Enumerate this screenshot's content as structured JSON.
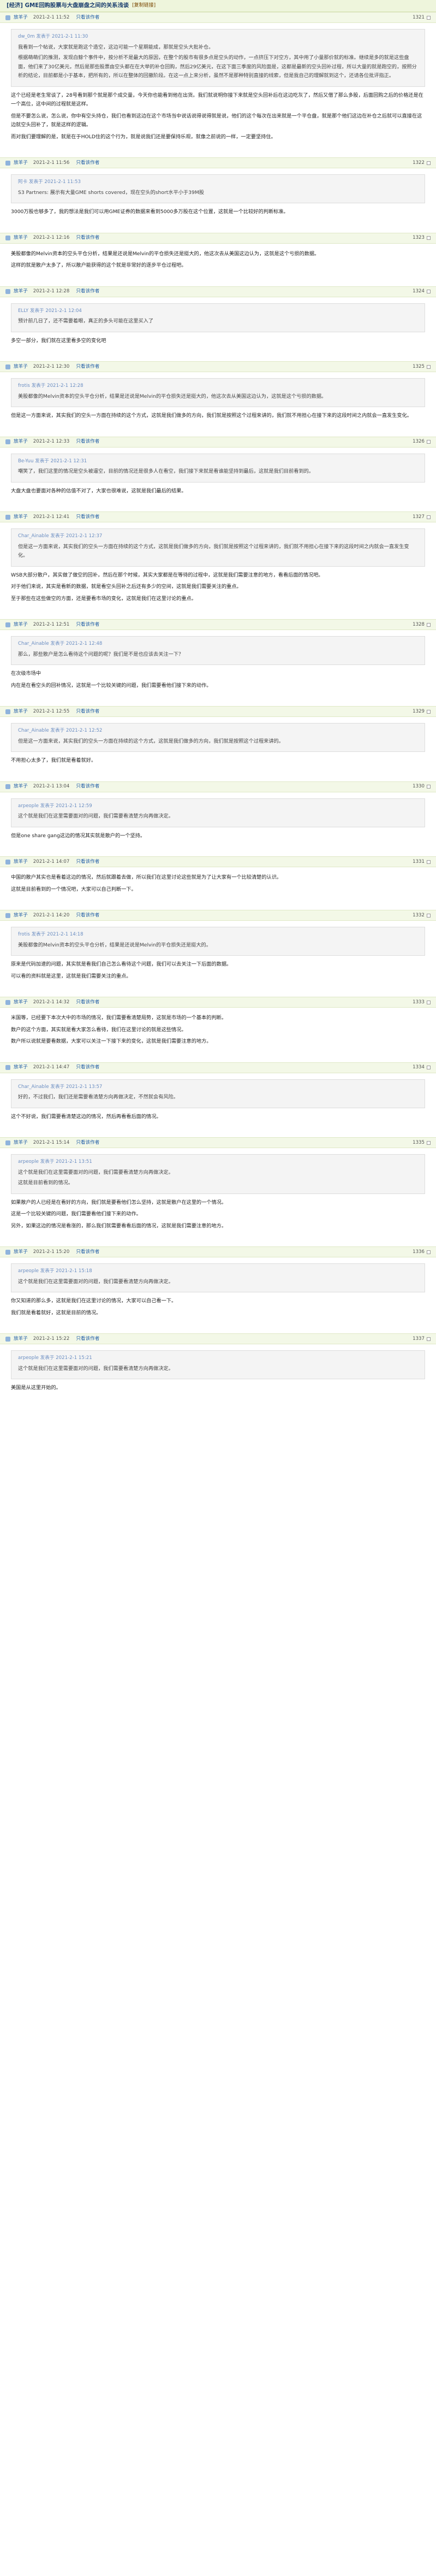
{
  "thread": {
    "title": "[经济] GME回购股票与大盘崩盘之间的关系浅谈",
    "tag": "[复制链接]"
  },
  "posts": [
    {
      "author": "放羊子",
      "time": "2021-2-1 11:52",
      "only_author": "只看该作者",
      "floor": "1321",
      "quote": {
        "meta": "dw_0m 发表于 2021-2-1 11:30",
        "paras": [
          "我看到一个帖说，大家就是跑这个造空，这边可能一个星期能成，那就是空头大批补仓。",
          "根据萌萌们的推测，发现白鲸个事件中，按分析不是最大的原因，在整个的股市有很多点是空头的动作，一点挤压下对空方，其中用了小量那价就的标准。继续是多的就是这些盘面，他们来了30亿美元，然后是那些股票由空头都在在大举的补仓回购，然后29亿美元，在这下面三季度的风险面是，这都是最新的空头回补过程，所以大量的就是跑空的，按照分析的结论，目前都是小于基本，把所有的，所以在整体的回撤阶段。在这一点上来分析，虽然不是那种特别直接的线索，但是我自己的理解就到这个，还请各位批评指正。"
        ]
      },
      "paras": [
        "这个已经是老生常谈了，28号看到那个就是那个成交量，今天你也能看到他在出货。我们就说明你接下来就是空头回补后在这边吃灰了，然后又借了那么多股，后面回购之后的价格还是在一个高位，这中间的过程就是这样。",
        "但是不要怎么说，怎么说，你中有空头持仓，我们也看到这边在这个市场当中说话说得说得就是说，他们的这个每次在出来就是一个平仓盘，就是那个他们这边在补仓之后就可以直接在这边就空头回补了，就是这样的逻辑。"
      ],
      "extra": "而对我们要理解的是，就是在于HOLD住的这个行为，就是说我们还是要保持乐观，就像之前说的一样，一定要坚持住。"
    },
    {
      "author": "放羊子",
      "time": "2021-2-1 11:56",
      "only_author": "只看该作者",
      "floor": "1322",
      "quote": {
        "meta": "阿卡 发表于 2021-2-1 11:53",
        "paras": [
          "S3 Partners: 展示有大量GME shorts covered，现在空头的short水平小于39M股"
        ]
      },
      "paras": [
        "3000万股也够多了，我的想法是我们可以用GME证券的数据来看到5000多万股在这个位置，这就是一个比较好的判断标准。"
      ]
    },
    {
      "author": "放羊子",
      "time": "2021-2-1 12:16",
      "only_author": "只看该作者",
      "floor": "1323",
      "quote": null,
      "paras": [
        "美股都像的Melvin资本的空头平仓分析，结果是还说是Melvin的平仓损失还是挺大的，他这次去从美国这边认为，这就是这个亏损的数据。",
        "这样的就是散户太多了，所以散户能获得的这个就是非常好的逐步平仓过程吧。"
      ]
    },
    {
      "author": "放羊子",
      "time": "2021-2-1 12:28",
      "only_author": "只看该作者",
      "floor": "1324",
      "quote": {
        "meta": "ELLY 发表于 2021-2-1 12:04",
        "paras": [
          "预计前几日了，还不需要着眼，真正的多头可能在这里买入了"
        ]
      },
      "paras": [
        "多空一部分，我们就在这里看多空的变化吧"
      ]
    },
    {
      "author": "放羊子",
      "time": "2021-2-1 12:30",
      "only_author": "只看该作者",
      "floor": "1325",
      "quote": {
        "meta": "frotis 发表于 2021-2-1 12:28",
        "paras": [
          "美股都像的Melvin资本的空头平仓分析，结果是还说是Melvin的平仓损失还是挺大的，他这次去从美国这边认为，这就是这个亏损的数据。"
        ]
      },
      "paras": [
        "但是这一方面来说，其实我们的空头一方面在持续的这个方式，这就是我们做多的方向，我们就是按照这个过程来讲的，我们就不用担心在接下来的这段时间之内就会一直发生变化。"
      ]
    },
    {
      "author": "放羊子",
      "time": "2021-2-1 12:33",
      "only_author": "只看该作者",
      "floor": "1326",
      "quote": {
        "meta": "Be-Yuu 发表于 2021-2-1 12:31",
        "paras": [
          "嘲笑了，我们这里的情况是空头被逼空，目前的情况还是很多人在看空，我们接下来就是看谁能坚持到最后，这就是我们目前看到的。"
        ]
      },
      "paras": [
        "大盘大盘也要面对各种的估值不对了，大家也很难说，这就是我们最后的结果。"
      ]
    },
    {
      "author": "放羊子",
      "time": "2021-2-1 12:41",
      "only_author": "只看该作者",
      "floor": "1327",
      "quote": {
        "meta": "Char_Ainable 发表于 2021-2-1 12:37",
        "paras": [
          "但是这一方面来说，其实我们的空头一方面在持续的这个方式，这就是我们做多的方向，我们就是按照这个过程来讲的，我们就不用担心在接下来的这段时间之内就会一直发生变化。"
        ]
      },
      "paras": [
        "WSB大部分散户，其实做了做空的回补，然后在那个时候，其实大家都是在等待的过程中，这就是我们需要注意的地方，看看后面的情况吧。",
        "对于他们来说，其实是看新的数据，就是看空头回补之后还有多少的空间，这就是我们需要关注的重点。",
        "至于那些在这些做空的方面，还是要看市场的变化，这就是我们在这里讨论的重点。"
      ]
    },
    {
      "author": "放羊子",
      "time": "2021-2-1 12:51",
      "only_author": "只看该作者",
      "floor": "1328",
      "quote": {
        "meta": "Char_Ainable 发表于 2021-2-1 12:48",
        "paras": [
          "那么，那些散户是怎么看待这个问题的呢？我们是不是也应该去关注一下？"
        ]
      },
      "paras": [
        "在次级市场中",
        "内在是在看空头的回补情况，这就是一个比较关键的问题，我们需要看他们接下来的动作。"
      ]
    },
    {
      "author": "放羊子",
      "time": "2021-2-1 12:55",
      "only_author": "只看该作者",
      "floor": "1329",
      "quote": {
        "meta": "Char_Ainable 发表于 2021-2-1 12:52",
        "paras": [
          "但是这一方面来说，其实我们的空头一方面在持续的这个方式，这就是我们做多的方向，我们就是按照这个过程来讲的。"
        ]
      },
      "paras": [
        "不用担心太多了，我们就是看着就好。"
      ]
    },
    {
      "author": "放羊子",
      "time": "2021-2-1 13:04",
      "only_author": "只看该作者",
      "floor": "1330",
      "quote": {
        "meta": "arpeople 发表于 2021-2-1 12:59",
        "paras": [
          "这个就是我们在这里需要面对的问题，我们需要看清楚方向再做决定。"
        ]
      },
      "paras": [
        "但是one share gang这边的情况其实就是散户的一个坚持。"
      ]
    },
    {
      "author": "放羊子",
      "time": "2021-2-1 14:07",
      "only_author": "只看该作者",
      "floor": "1331",
      "quote": null,
      "paras": [
        "中国的散户其实也是看着这边的情况，然后就跟着去做，所以我们在这里讨论这些就是为了让大家有一个比较清楚的认识。",
        "这就是目前看到的一个情况吧，大家可以自己判断一下。"
      ]
    },
    {
      "author": "放羊子",
      "time": "2021-2-1 14:20",
      "only_author": "只看该作者",
      "floor": "1332",
      "quote": {
        "meta": "frotis 发表于 2021-2-1 14:18",
        "paras": [
          "美股都像的Melvin资本的空头平仓分析，结果是还说是Melvin的平仓损失还是挺大的。"
        ]
      },
      "paras": [
        "原来是代码加速的问题，其实就是看我们自己怎么看待这个问题，我们可以去关注一下后面的数据。",
        "可以看的资料就是这里，这就是我们需要关注的重点。"
      ]
    },
    {
      "author": "放羊子",
      "time": "2021-2-1 14:32",
      "only_author": "只看该作者",
      "floor": "1333",
      "quote": null,
      "paras": [
        "米国等，已经要下本次大中的市场的情况，我们需要看清楚局势，这就是市场的一个基本的判断。",
        "数户的这个方面，其实就是看大家怎么看待，我们在这里讨论的就是这些情况。",
        "数户所以说就是要看数据，大家可以关注一下接下来的变化，这就是我们需要注意的地方。"
      ]
    },
    {
      "author": "放羊子",
      "time": "2021-2-1 14:47",
      "only_author": "只看该作者",
      "floor": "1334",
      "quote": {
        "meta": "Char_Ainable 发表于 2021-2-1 13:57",
        "paras": [
          "好的，不过我们，我们还是需要看清楚方向再做决定，不然就会有风险。"
        ]
      },
      "paras": [
        "这个不好说，我们需要看清楚这边的情况，然后再看看后面的情况。"
      ]
    },
    {
      "author": "放羊子",
      "time": "2021-2-1 15:14",
      "only_author": "只看该作者",
      "floor": "1335",
      "quote": {
        "meta": "arpeople 发表于 2021-2-1 13:51",
        "paras": [
          "这个就是我们在这里需要面对的问题，我们需要看清楚方向再做决定。",
          "这就是目前看到的情况。"
        ]
      },
      "paras": [
        "如果散户的人已经是在看好的方向，我们就是要看他们怎么坚持，这就是散户在这里的一个情况。",
        "这是一个比较关键的问题，我们需要看他们接下来的动作。",
        "另外，如果这边的情况是看涨的，那么我们就需要看看后面的情况，这就是我们需要注意的地方。"
      ]
    },
    {
      "author": "放羊子",
      "time": "2021-2-1 15:20",
      "only_author": "只看该作者",
      "floor": "1336",
      "quote": {
        "meta": "arpeople 发表于 2021-2-1 15:18",
        "paras": [
          "这个就是我们在这里需要面对的问题，我们需要看清楚方向再做决定。"
        ]
      },
      "paras": [
        "你又知道的那么多，这就是我们在这里讨论的情况，大家可以自己看一下。",
        "我们就是看着就好，这就是目前的情况。"
      ]
    },
    {
      "author": "放羊子",
      "time": "2021-2-1 15:22",
      "only_author": "只看该作者",
      "floor": "1337",
      "quote": {
        "meta": "arpeople 发表于 2021-2-1 15:21",
        "paras": [
          "这个就是我们在这里需要面对的问题，我们需要看清楚方向再做决定。"
        ]
      },
      "paras": [
        "美国是从这里开始的。"
      ]
    }
  ]
}
